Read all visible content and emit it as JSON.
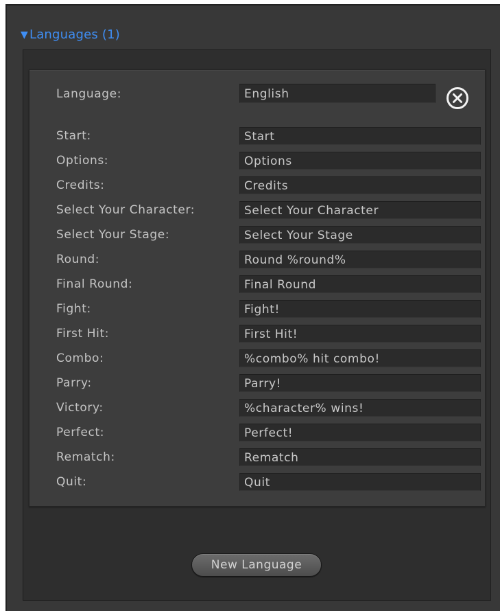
{
  "foldout": {
    "arrow": "▼",
    "label": "Languages (1)"
  },
  "language": {
    "label": "Language:",
    "value": "English"
  },
  "entries": [
    {
      "label": "Start:",
      "value": "Start"
    },
    {
      "label": "Options:",
      "value": "Options"
    },
    {
      "label": "Credits:",
      "value": "Credits"
    },
    {
      "label": "Select Your Character:",
      "value": "Select Your Character"
    },
    {
      "label": "Select Your Stage:",
      "value": "Select Your Stage"
    },
    {
      "label": "Round:",
      "value": "Round %round%"
    },
    {
      "label": "Final Round:",
      "value": "Final Round"
    },
    {
      "label": "Fight:",
      "value": "Fight!"
    },
    {
      "label": "First Hit:",
      "value": "First Hit!"
    },
    {
      "label": "Combo:",
      "value": "%combo% hit combo!"
    },
    {
      "label": "Parry:",
      "value": "Parry!"
    },
    {
      "label": "Victory:",
      "value": "%character% wins!"
    },
    {
      "label": "Perfect:",
      "value": "Perfect!"
    },
    {
      "label": "Rematch:",
      "value": "Rematch"
    },
    {
      "label": "Quit:",
      "value": "Quit"
    }
  ],
  "buttons": {
    "new_language": "New Language",
    "remove_icon": "close-circle-icon"
  },
  "colors": {
    "foldout_text": "#3f8ef4",
    "panel_bg": "#383838",
    "field_bg": "#2b2b2b"
  }
}
